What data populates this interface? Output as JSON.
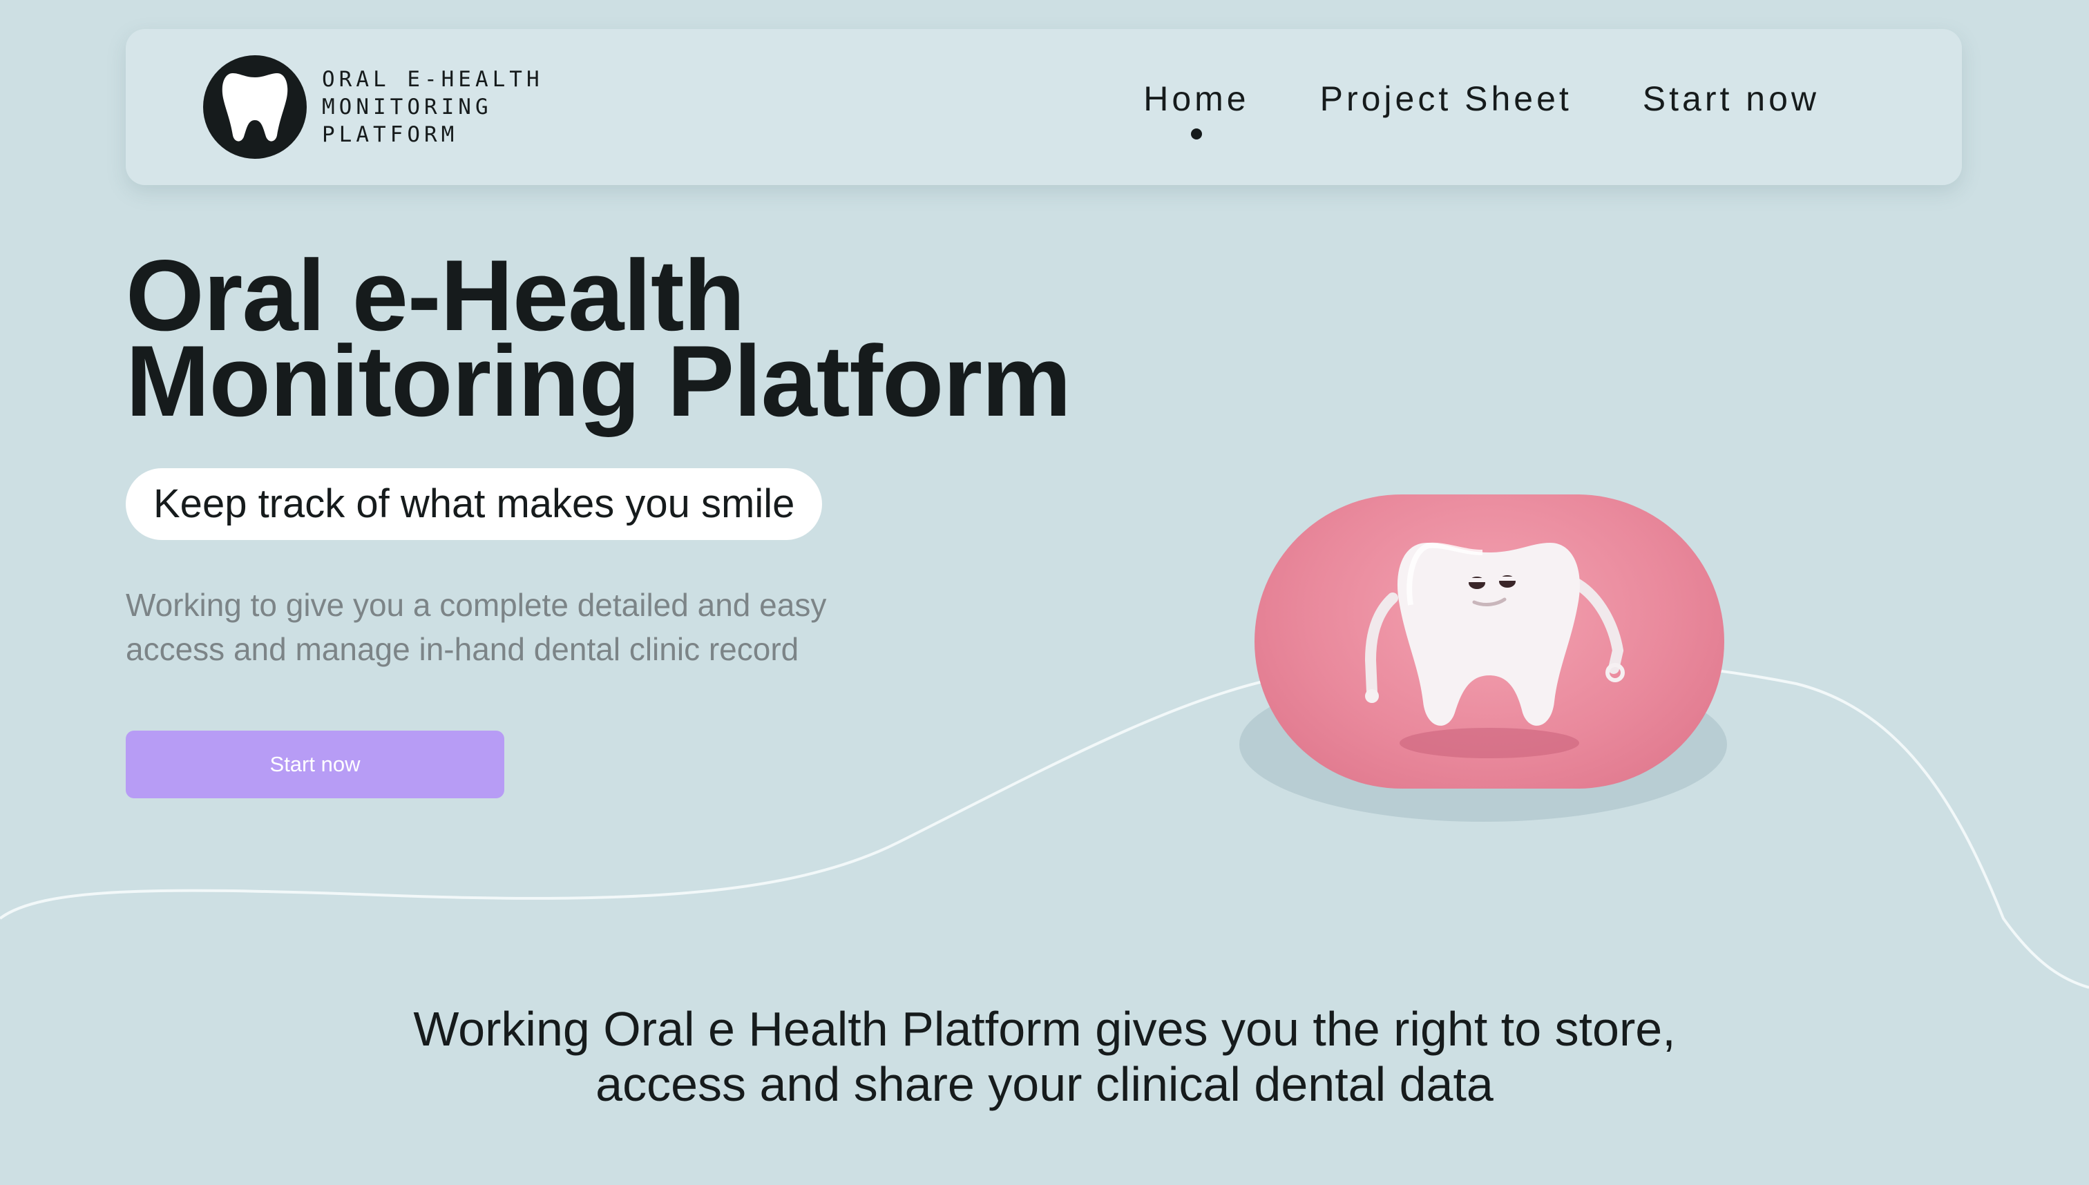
{
  "logo": {
    "icon": "tooth-icon",
    "text_line1": "ORAL E-HEALTH",
    "text_line2": "MONITORING",
    "text_line3": "PLATFORM"
  },
  "nav": {
    "items": [
      {
        "label": "Home",
        "active": true
      },
      {
        "label": "Project Sheet",
        "active": false
      },
      {
        "label": "Start now",
        "active": false
      }
    ]
  },
  "hero": {
    "title_line1": "Oral e-Health",
    "title_line2": "Monitoring Platform",
    "tagline": "Keep track of what makes you smile",
    "description": "Working to give you a complete detailed and easy access and manage in-hand dental clinic record",
    "cta_label": "Start now",
    "image": "tooth-character-illustration"
  },
  "info": {
    "line1": "Working Oral e Health Platform gives you the right to store,",
    "line2": "access and share your clinical dental data"
  },
  "colors": {
    "background": "#cddfe3",
    "accent": "#b79cf5",
    "text": "#161b1c",
    "muted": "#7c8487",
    "pill": "#e9899c"
  }
}
